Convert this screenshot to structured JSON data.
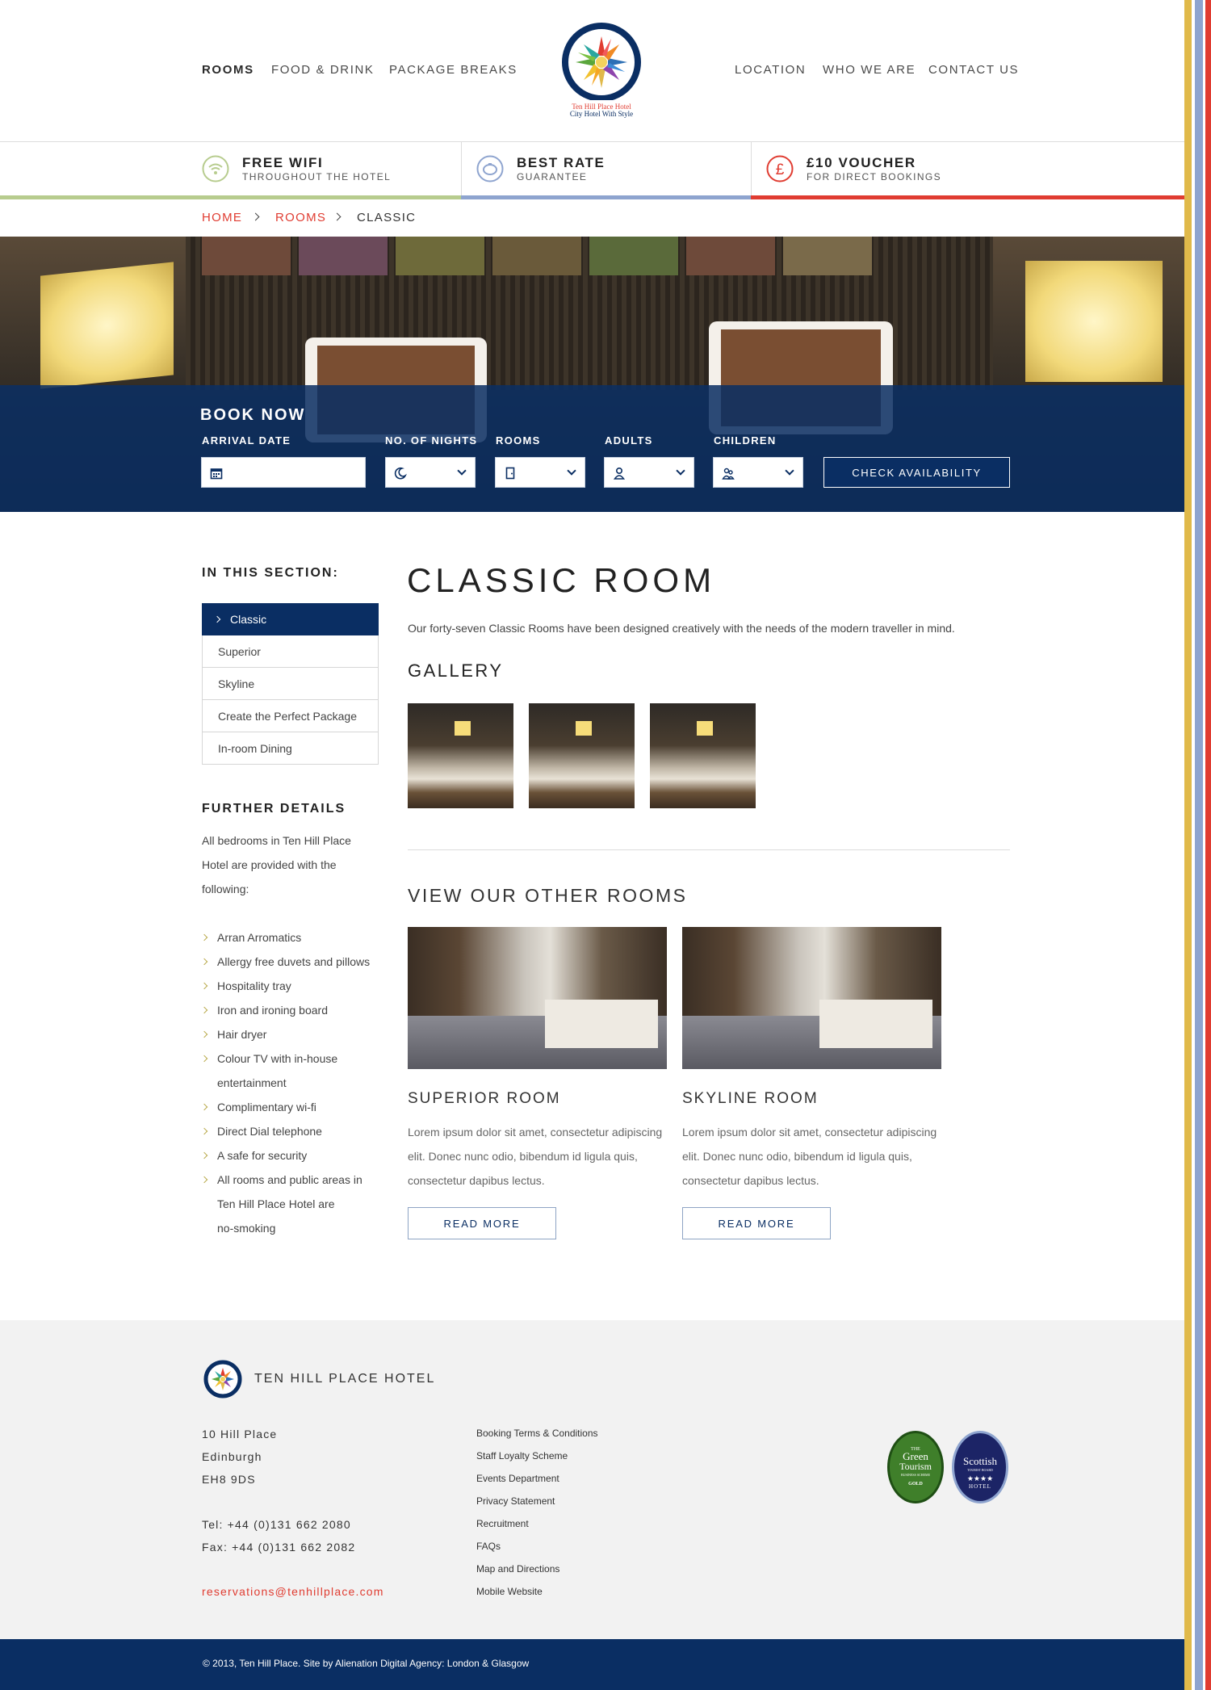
{
  "colors": {
    "navy": "#0a2e63",
    "accent_red": "#e03c31",
    "stripe_yellow": "#e0b94a",
    "stripe_blue": "#8ea4cf",
    "stripe_red": "#e03c31",
    "usp_green": "#b7cc8e",
    "footer_bg": "#f2f2f2"
  },
  "header": {
    "nav_left": [
      "ROOMS",
      "FOOD & DRINK",
      "PACKAGE BREAKS"
    ],
    "nav_right": [
      "LOCATION",
      "WHO WE ARE",
      "CONTACT US"
    ],
    "logo": {
      "name": "Ten Hill Place Hotel",
      "tagline": "City Hotel With Style"
    }
  },
  "usp": [
    {
      "icon": "wifi-icon",
      "title": "FREE WIFI",
      "sub": "THROUGHOUT THE HOTEL"
    },
    {
      "icon": "piggy-bank-icon",
      "title": "BEST RATE",
      "sub": "GUARANTEE"
    },
    {
      "icon": "pound-icon",
      "title": "£10 VOUCHER",
      "sub": "FOR DIRECT BOOKINGS"
    }
  ],
  "breadcrumb": [
    "HOME",
    "ROOMS",
    "CLASSIC"
  ],
  "booking": {
    "title": "BOOK NOW",
    "labels": [
      "ARRIVAL DATE",
      "NO. OF NIGHTS",
      "ROOMS",
      "ADULTS",
      "CHILDREN"
    ],
    "button": "CHECK AVAILABILITY"
  },
  "sidebar": {
    "heading": "IN THIS SECTION:",
    "items": [
      "Classic",
      "Superior",
      "Skyline",
      "Create the Perfect Package",
      "In-room Dining"
    ],
    "further_heading": "FURTHER DETAILS",
    "further_intro": [
      "All bedrooms in Ten Hill Place",
      "Hotel are provided with the",
      "following:"
    ],
    "features": [
      "Arran Arromatics",
      "Allergy free duvets and pillows",
      "Hospitality tray",
      "Iron and ironing board",
      "Hair dryer",
      "Colour TV with in-house",
      "entertainment",
      "Complimentary wi-fi",
      "Direct Dial telephone",
      "A safe for security",
      "All rooms and public areas in",
      "Ten Hill Place Hotel are",
      "no-smoking"
    ]
  },
  "main": {
    "title": "CLASSIC ROOM",
    "intro": "Our forty-seven Classic Rooms have been designed creatively with the needs of the modern traveller in mind.",
    "gallery_heading": "GALLERY",
    "other_heading": "VIEW OUR OTHER ROOMS",
    "rooms": [
      {
        "title": "SUPERIOR ROOM",
        "text": "Lorem ipsum dolor sit amet, consectetur adipiscing elit. Donec nunc odio, bibendum id ligula quis, consectetur dapibus lectus.",
        "button": "READ MORE"
      },
      {
        "title": "SKYLINE ROOM",
        "text": "Lorem ipsum dolor sit amet, consectetur adipiscing elit. Donec nunc odio, bibendum id ligula quis, consectetur dapibus lectus.",
        "button": "READ MORE"
      }
    ]
  },
  "footer": {
    "hotel_name": "TEN HILL PLACE HOTEL",
    "address": [
      "10 Hill Place",
      "Edinburgh",
      "EH8 9DS"
    ],
    "tel": "Tel: +44 (0)131 662 2080",
    "fax": "Fax: +44 (0)131 662 2082",
    "email": "reservations@tenhillplace.com",
    "links": [
      "Booking Terms & Conditions",
      "Staff Loyalty Scheme",
      "Events Department",
      "Privacy Statement",
      "Recruitment",
      "FAQs",
      "Map and Directions",
      "Mobile Website"
    ],
    "badges": {
      "green": {
        "line1": "THE",
        "line2": "Green",
        "line3": "Tourism",
        "line4": "BUSINESS SCHEME",
        "line5": "GOLD"
      },
      "scottish": {
        "line1": "Scottish",
        "line2": "TOURIST BOARD",
        "line3": "★★★★",
        "line4": "HOTEL"
      }
    },
    "copyright": "© 2013, Ten Hill Place. Site by Alienation Digital Agency: London & Glasgow"
  }
}
